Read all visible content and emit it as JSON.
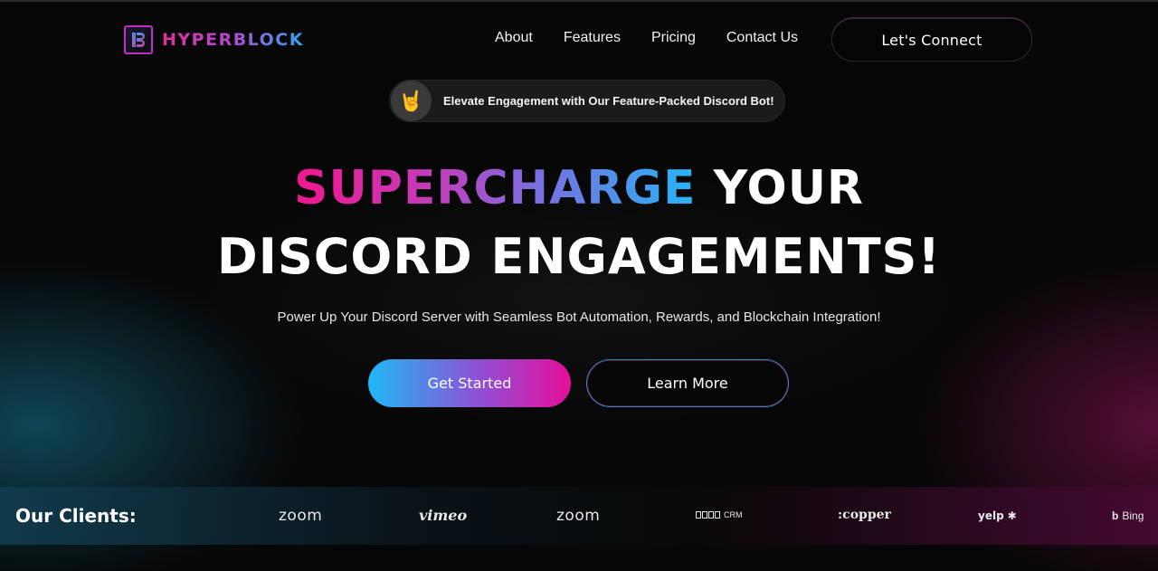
{
  "brand": {
    "name": "HYPERBLOCK",
    "icon": "hyperblock-logo-icon"
  },
  "nav": {
    "items": [
      {
        "label": "About"
      },
      {
        "label": "Features"
      },
      {
        "label": "Pricing"
      },
      {
        "label": "Contact Us"
      }
    ],
    "cta_label": "Let's Connect"
  },
  "announcement": {
    "icon": "rock-hand-icon",
    "emoji": "🤘",
    "text": "Elevate Engagement with Our Feature-Packed Discord Bot!"
  },
  "hero": {
    "headline_gradient": "SUPERCHARGE",
    "headline_rest": " YOUR",
    "headline_line2": "DISCORD ENGAGEMENTS!",
    "subtitle": "Power Up Your Discord Server with Seamless Bot Automation, Rewards, and Blockchain Integration!",
    "primary_button": "Get Started",
    "secondary_button": "Learn More"
  },
  "clients": {
    "title": "Our Clients:",
    "logos": [
      {
        "name": "zoom",
        "text": "zoom"
      },
      {
        "name": "vimeo",
        "text": "vimeo"
      },
      {
        "name": "zoom",
        "text": "zoom"
      },
      {
        "name": "crm",
        "text": "CRM"
      },
      {
        "name": "copper",
        "text": ":copper"
      },
      {
        "name": "yelp",
        "text": "yelp",
        "glyph": "✱"
      },
      {
        "name": "bing",
        "text": "Bing",
        "glyph": "b"
      }
    ]
  },
  "colors": {
    "accent_pink": "#e50f9a",
    "accent_blue": "#1fb8f5",
    "background": "#070707"
  }
}
